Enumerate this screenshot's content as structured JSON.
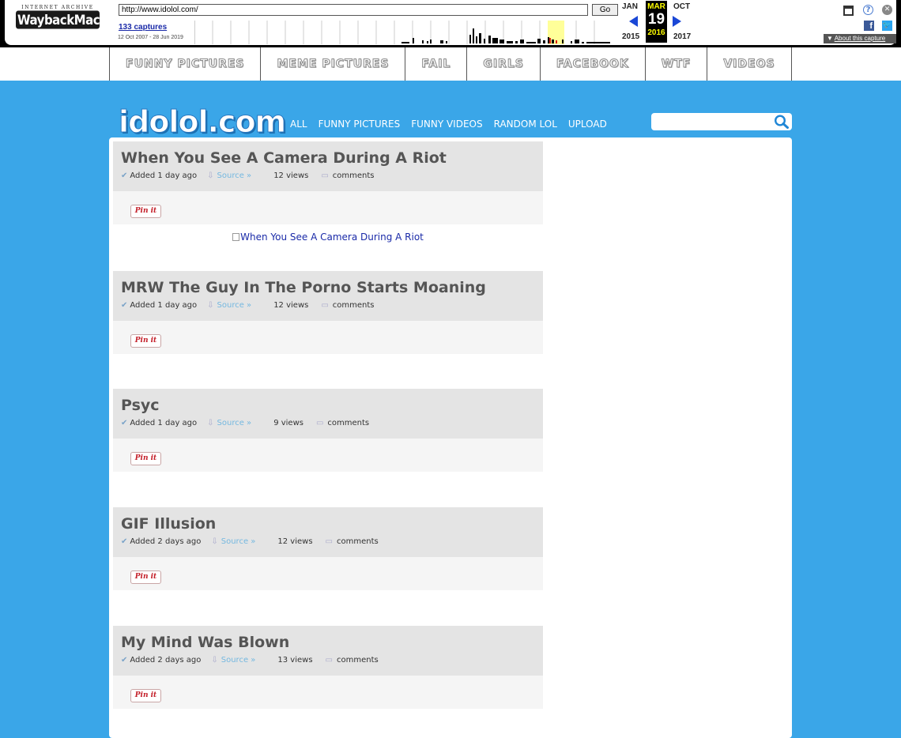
{
  "wayback": {
    "logo_top": "INTERNET ARCHIVE",
    "logo_main": "WaybackMachine",
    "url": "http://www.idolol.com/",
    "go_label": "Go",
    "captures": "133 captures",
    "range": "12 Oct 2007 - 28 Jun 2019",
    "prev_month": "JAN",
    "cur_month": "MAR",
    "cur_day": "19",
    "next_month": "OCT",
    "prev_year": "2015",
    "cur_year": "2016",
    "next_year": "2017",
    "about": "About this capture"
  },
  "categories": [
    "FUNNY PICTURES",
    "MEME PICTURES",
    "FAIL",
    "GIRLS",
    "FACEBOOK",
    "WTF",
    "VIDEOS"
  ],
  "site": {
    "logo": "idolol.com",
    "nav": [
      "ALL",
      "FUNNY PICTURES",
      "FUNNY VIDEOS",
      "RANDOM LOL",
      "UPLOAD"
    ],
    "search_value": ""
  },
  "posts": [
    {
      "title": "When You See A Camera During A Riot",
      "added": "Added 1 day ago",
      "source": "Source »",
      "views": "12 views",
      "comments": "comments",
      "pin": "Pin it",
      "image_alt": "When You See A Camera During A Riot"
    },
    {
      "title": "MRW The Guy In The Porno Starts Moaning",
      "added": "Added 1 day ago",
      "source": "Source »",
      "views": "12 views",
      "comments": "comments",
      "pin": "Pin it"
    },
    {
      "title": "Psyc",
      "added": "Added 1 day ago",
      "source": "Source »",
      "views": "9 views",
      "comments": "comments",
      "pin": "Pin it"
    },
    {
      "title": "GIF Illusion",
      "added": "Added 2 days ago",
      "source": "Source »",
      "views": "12 views",
      "comments": "comments",
      "pin": "Pin it"
    },
    {
      "title": "My Mind Was Blown",
      "added": "Added 2 days ago",
      "source": "Source »",
      "views": "13 views",
      "comments": "comments",
      "pin": "Pin it"
    }
  ]
}
